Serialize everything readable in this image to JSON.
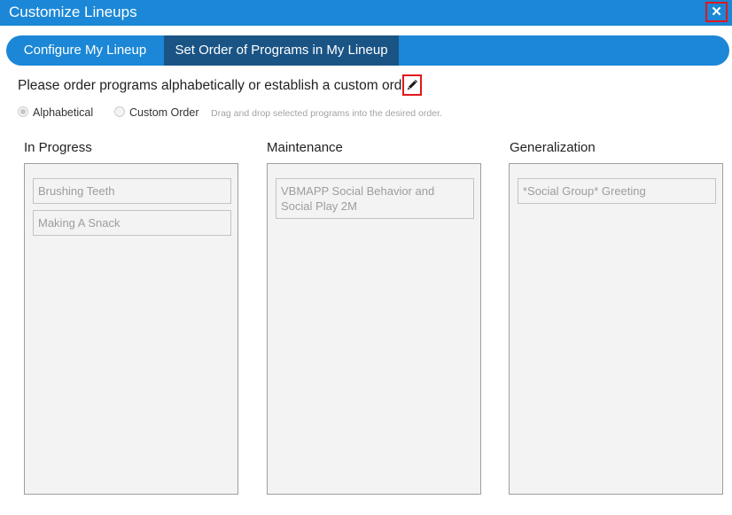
{
  "window": {
    "title": "Customize Lineups",
    "close_symbol": "✕"
  },
  "tabs": [
    {
      "label": "Configure My Lineup",
      "active": false
    },
    {
      "label": "Set Order of Programs in My Lineup",
      "active": true
    }
  ],
  "instruction": "Please order programs alphabetically or establish a custom order.",
  "edit_icon": "pencil-icon",
  "order_options": {
    "alphabetical": {
      "label": "Alphabetical",
      "checked": true
    },
    "custom": {
      "label": "Custom Order",
      "checked": false
    },
    "hint": "Drag and drop selected programs into the desired order."
  },
  "columns": [
    {
      "title": "In Progress",
      "items": [
        "Brushing Teeth",
        "Making A Snack"
      ]
    },
    {
      "title": "Maintenance",
      "items": [
        "VBMAPP Social Behavior and Social Play 2M"
      ]
    },
    {
      "title": "Generalization",
      "items": [
        "*Social Group* Greeting"
      ]
    }
  ],
  "colors": {
    "accent": "#1b87d6",
    "active_tab": "#1a5485",
    "highlight_border": "#e3171b"
  }
}
